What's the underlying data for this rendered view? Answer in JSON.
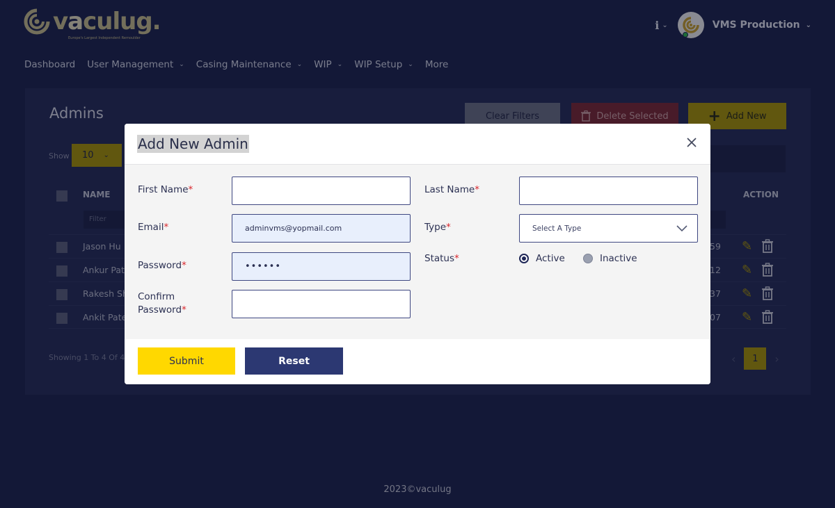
{
  "app": {
    "logo_text": "v",
    "logo_accent": "a",
    "logo_rest": "culug.",
    "logo_tagline": "Europe's Largest Independent Remoulder"
  },
  "header": {
    "info_icon": "info-icon",
    "account_name": "VMS Production"
  },
  "nav": {
    "items": [
      {
        "label": "Dashboard",
        "dropdown": false
      },
      {
        "label": "User Management",
        "dropdown": true
      },
      {
        "label": "Casing Maintenance",
        "dropdown": true
      },
      {
        "label": "WIP",
        "dropdown": true
      },
      {
        "label": "WIP Setup",
        "dropdown": true
      },
      {
        "label": "More",
        "dropdown": false
      }
    ]
  },
  "page": {
    "title": "Admins",
    "clear_filters": "Clear Filters",
    "delete_selected": "Delete Selected",
    "add_new": "Add New",
    "show_label": "Show",
    "show_value": "10",
    "columns": {
      "name": "NAME",
      "action": "ACTION"
    },
    "filter_placeholder": "Filter",
    "rows": [
      {
        "name": "Jason Hu",
        "phone": "59"
      },
      {
        "name": "Ankur Pate",
        "phone": "12"
      },
      {
        "name": "Rakesh Sh",
        "phone": "37"
      },
      {
        "name": "Ankit Pate",
        "phone": "07"
      }
    ],
    "showing": "Showing 1 To 4 Of 4",
    "current_page": "1"
  },
  "footer": {
    "text": "2023©vaculug"
  },
  "modal": {
    "title": "Add New Admin",
    "fields": {
      "first_name": {
        "label": "First Name",
        "value": ""
      },
      "last_name": {
        "label": "Last Name",
        "value": ""
      },
      "email": {
        "label": "Email",
        "value": "adminvms@yopmail.com"
      },
      "type": {
        "label": "Type",
        "placeholder": "Select A Type"
      },
      "password": {
        "label": "Password",
        "value": "••••••"
      },
      "status": {
        "label": "Status",
        "options": [
          "Active",
          "Inactive"
        ],
        "selected": "Active"
      },
      "confirm_password": {
        "label_line1": "Confirm",
        "label_line2": "Password",
        "value": ""
      }
    },
    "required_mark": "*",
    "submit": "Submit",
    "reset": "Reset"
  },
  "colors": {
    "background": "#1a2149",
    "accent_yellow": "#ffd800",
    "primary_navy": "#2c3872",
    "danger": "#d9262c"
  }
}
